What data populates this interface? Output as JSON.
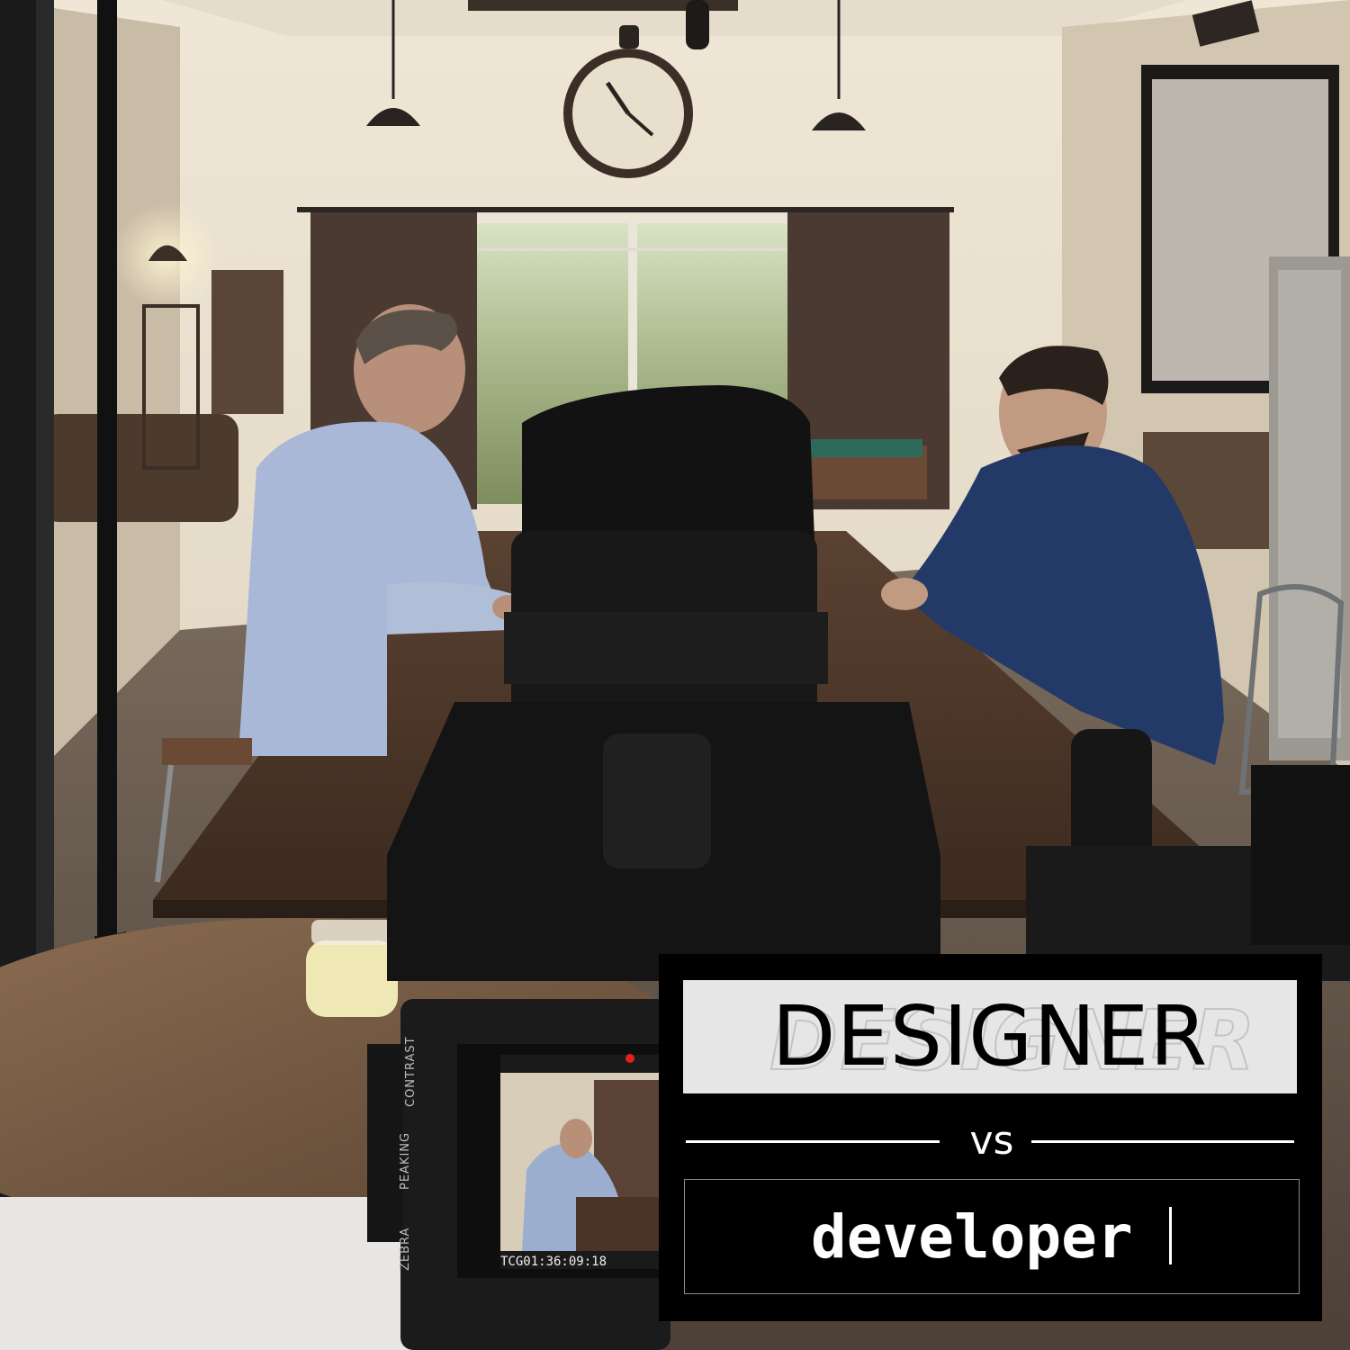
{
  "title_card": {
    "designer": "DESIGNER",
    "vs": "vs",
    "developer": "developer"
  },
  "monitor": {
    "labels": [
      "ZEBRA",
      "PEAKING",
      "CONTRAST"
    ],
    "timecode": "TCG01:36:09:18"
  },
  "colors": {
    "card_background": "#000000",
    "designer_band": "#e6e6e6",
    "text_light": "#ffffff"
  }
}
